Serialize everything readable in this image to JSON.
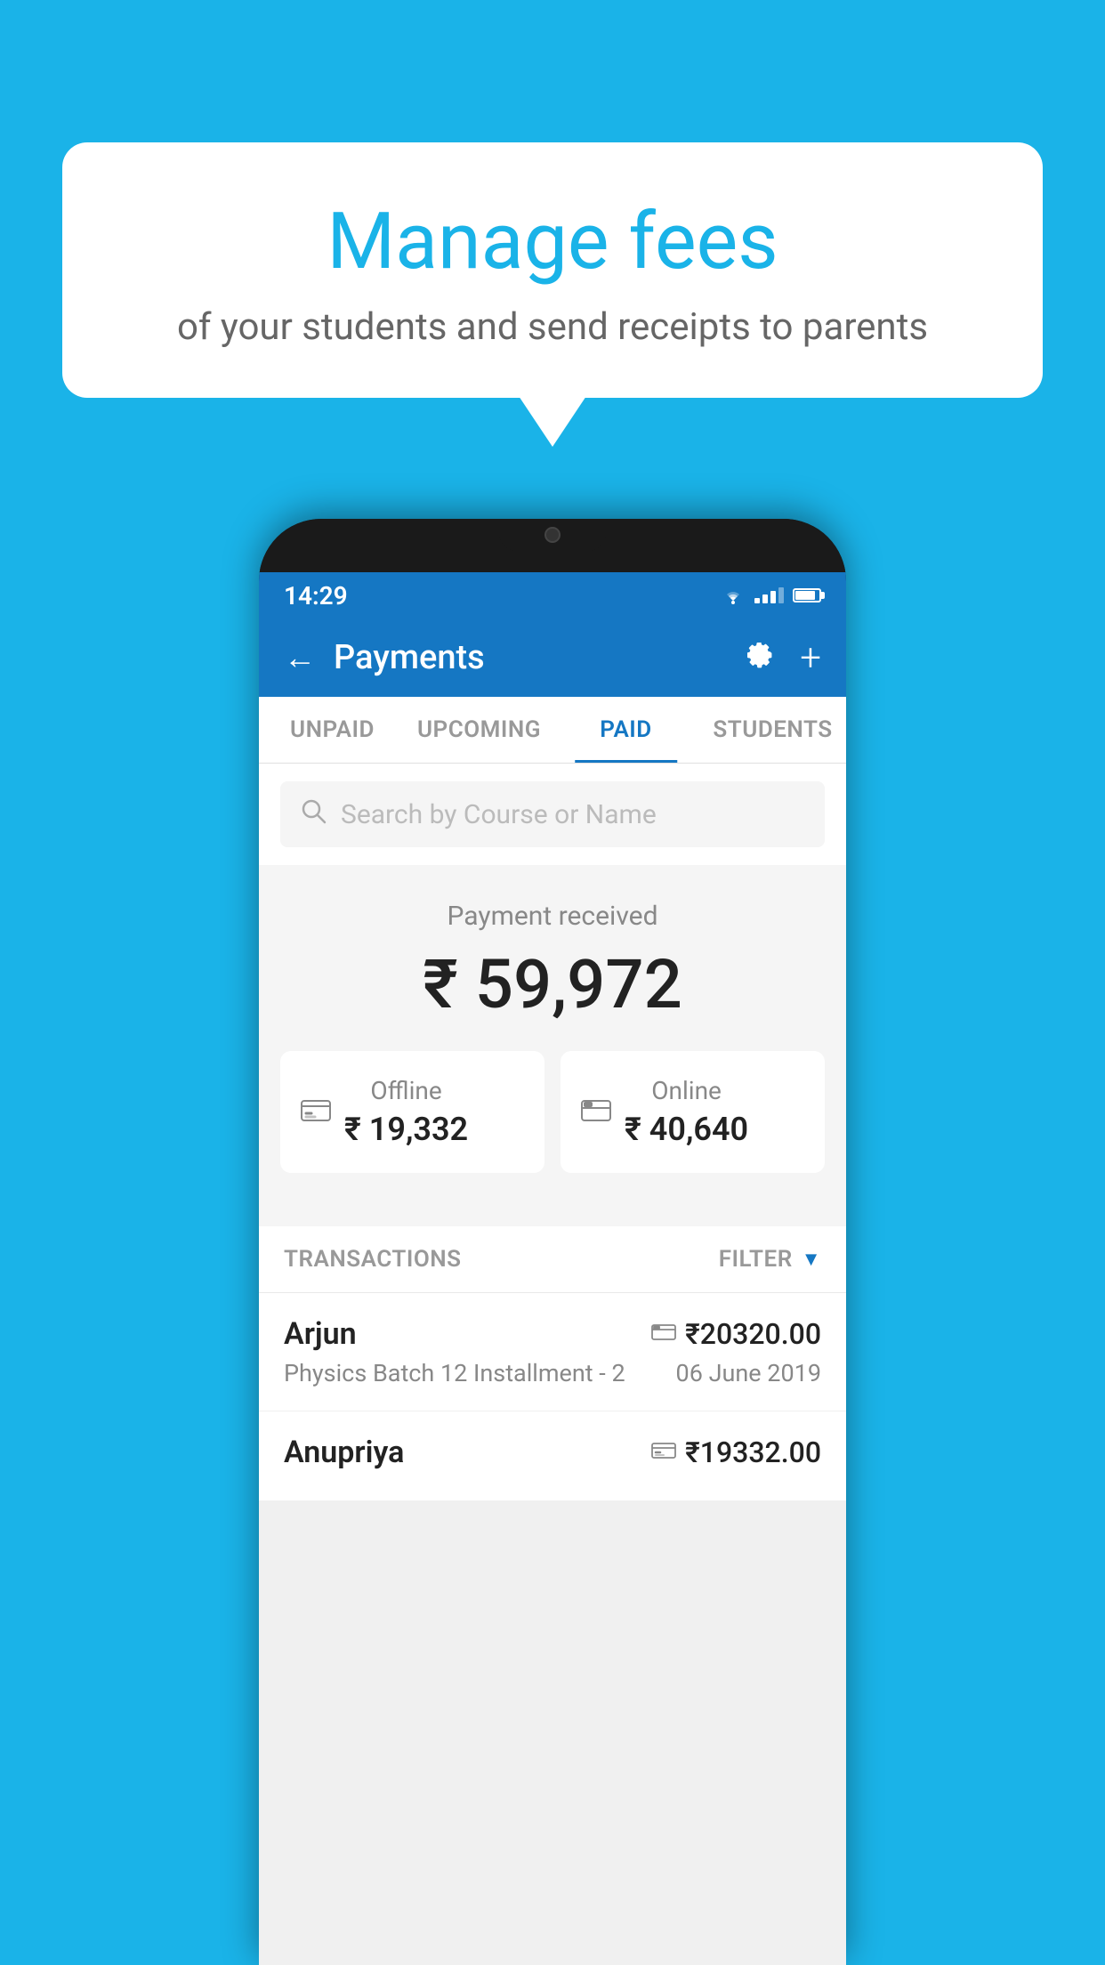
{
  "page": {
    "background_color": "#1ab3e8"
  },
  "speech_bubble": {
    "title": "Manage fees",
    "subtitle": "of your students and send receipts to parents"
  },
  "status_bar": {
    "time": "14:29"
  },
  "header": {
    "title": "Payments",
    "back_label": "←",
    "settings_icon": "⚙",
    "add_icon": "+"
  },
  "tabs": [
    {
      "label": "UNPAID",
      "active": false
    },
    {
      "label": "UPCOMING",
      "active": false
    },
    {
      "label": "PAID",
      "active": true
    },
    {
      "label": "STUDENTS",
      "active": false
    }
  ],
  "search": {
    "placeholder": "Search by Course or Name"
  },
  "payment_received": {
    "label": "Payment received",
    "total_amount": "₹ 59,972",
    "offline": {
      "label": "Offline",
      "amount": "₹ 19,332"
    },
    "online": {
      "label": "Online",
      "amount": "₹ 40,640"
    }
  },
  "transactions": {
    "header_label": "TRANSACTIONS",
    "filter_label": "FILTER",
    "rows": [
      {
        "name": "Arjun",
        "course": "Physics Batch 12 Installment - 2",
        "amount": "₹20320.00",
        "date": "06 June 2019",
        "payment_type": "card"
      },
      {
        "name": "Anupriya",
        "course": "",
        "amount": "₹19332.00",
        "date": "",
        "payment_type": "offline"
      }
    ]
  }
}
